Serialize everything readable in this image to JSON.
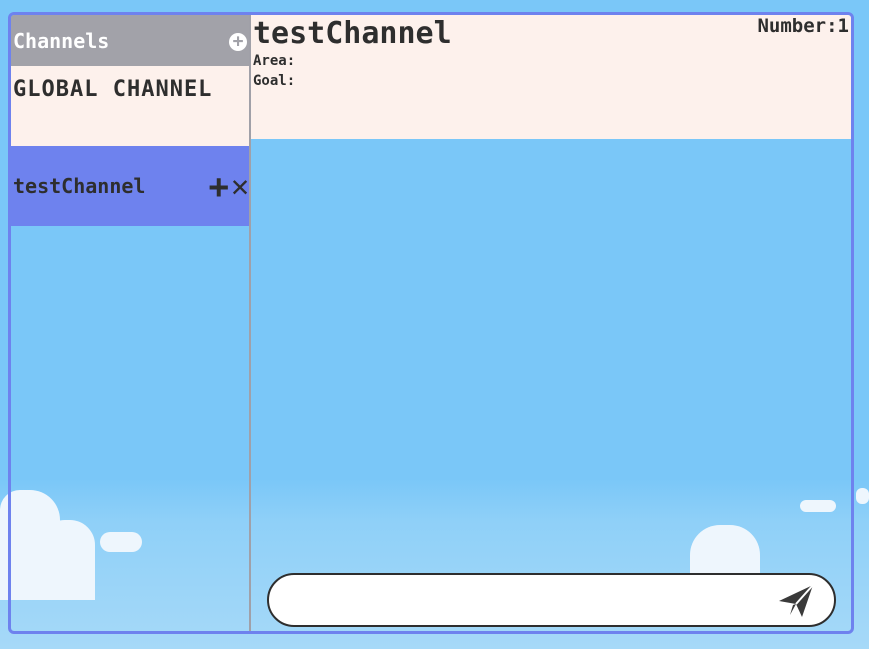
{
  "sidebar": {
    "title": "Channels",
    "add_icon": "plus-circle-icon",
    "channels": [
      {
        "label": "GLOBAL CHANNEL",
        "active": false
      },
      {
        "label": "testChannel",
        "active": true
      }
    ]
  },
  "main": {
    "title": "testChannel",
    "area_label": "Area:",
    "goal_label": "Goal:",
    "number_text": "Number:1"
  },
  "composer": {
    "value": "",
    "placeholder": "",
    "send_icon": "paper-plane-icon"
  },
  "colors": {
    "accent": "#6e82ee",
    "header_bg": "#a2a2a9",
    "panel_bg": "#fdf1ec",
    "sky": "#7ac7f8"
  }
}
